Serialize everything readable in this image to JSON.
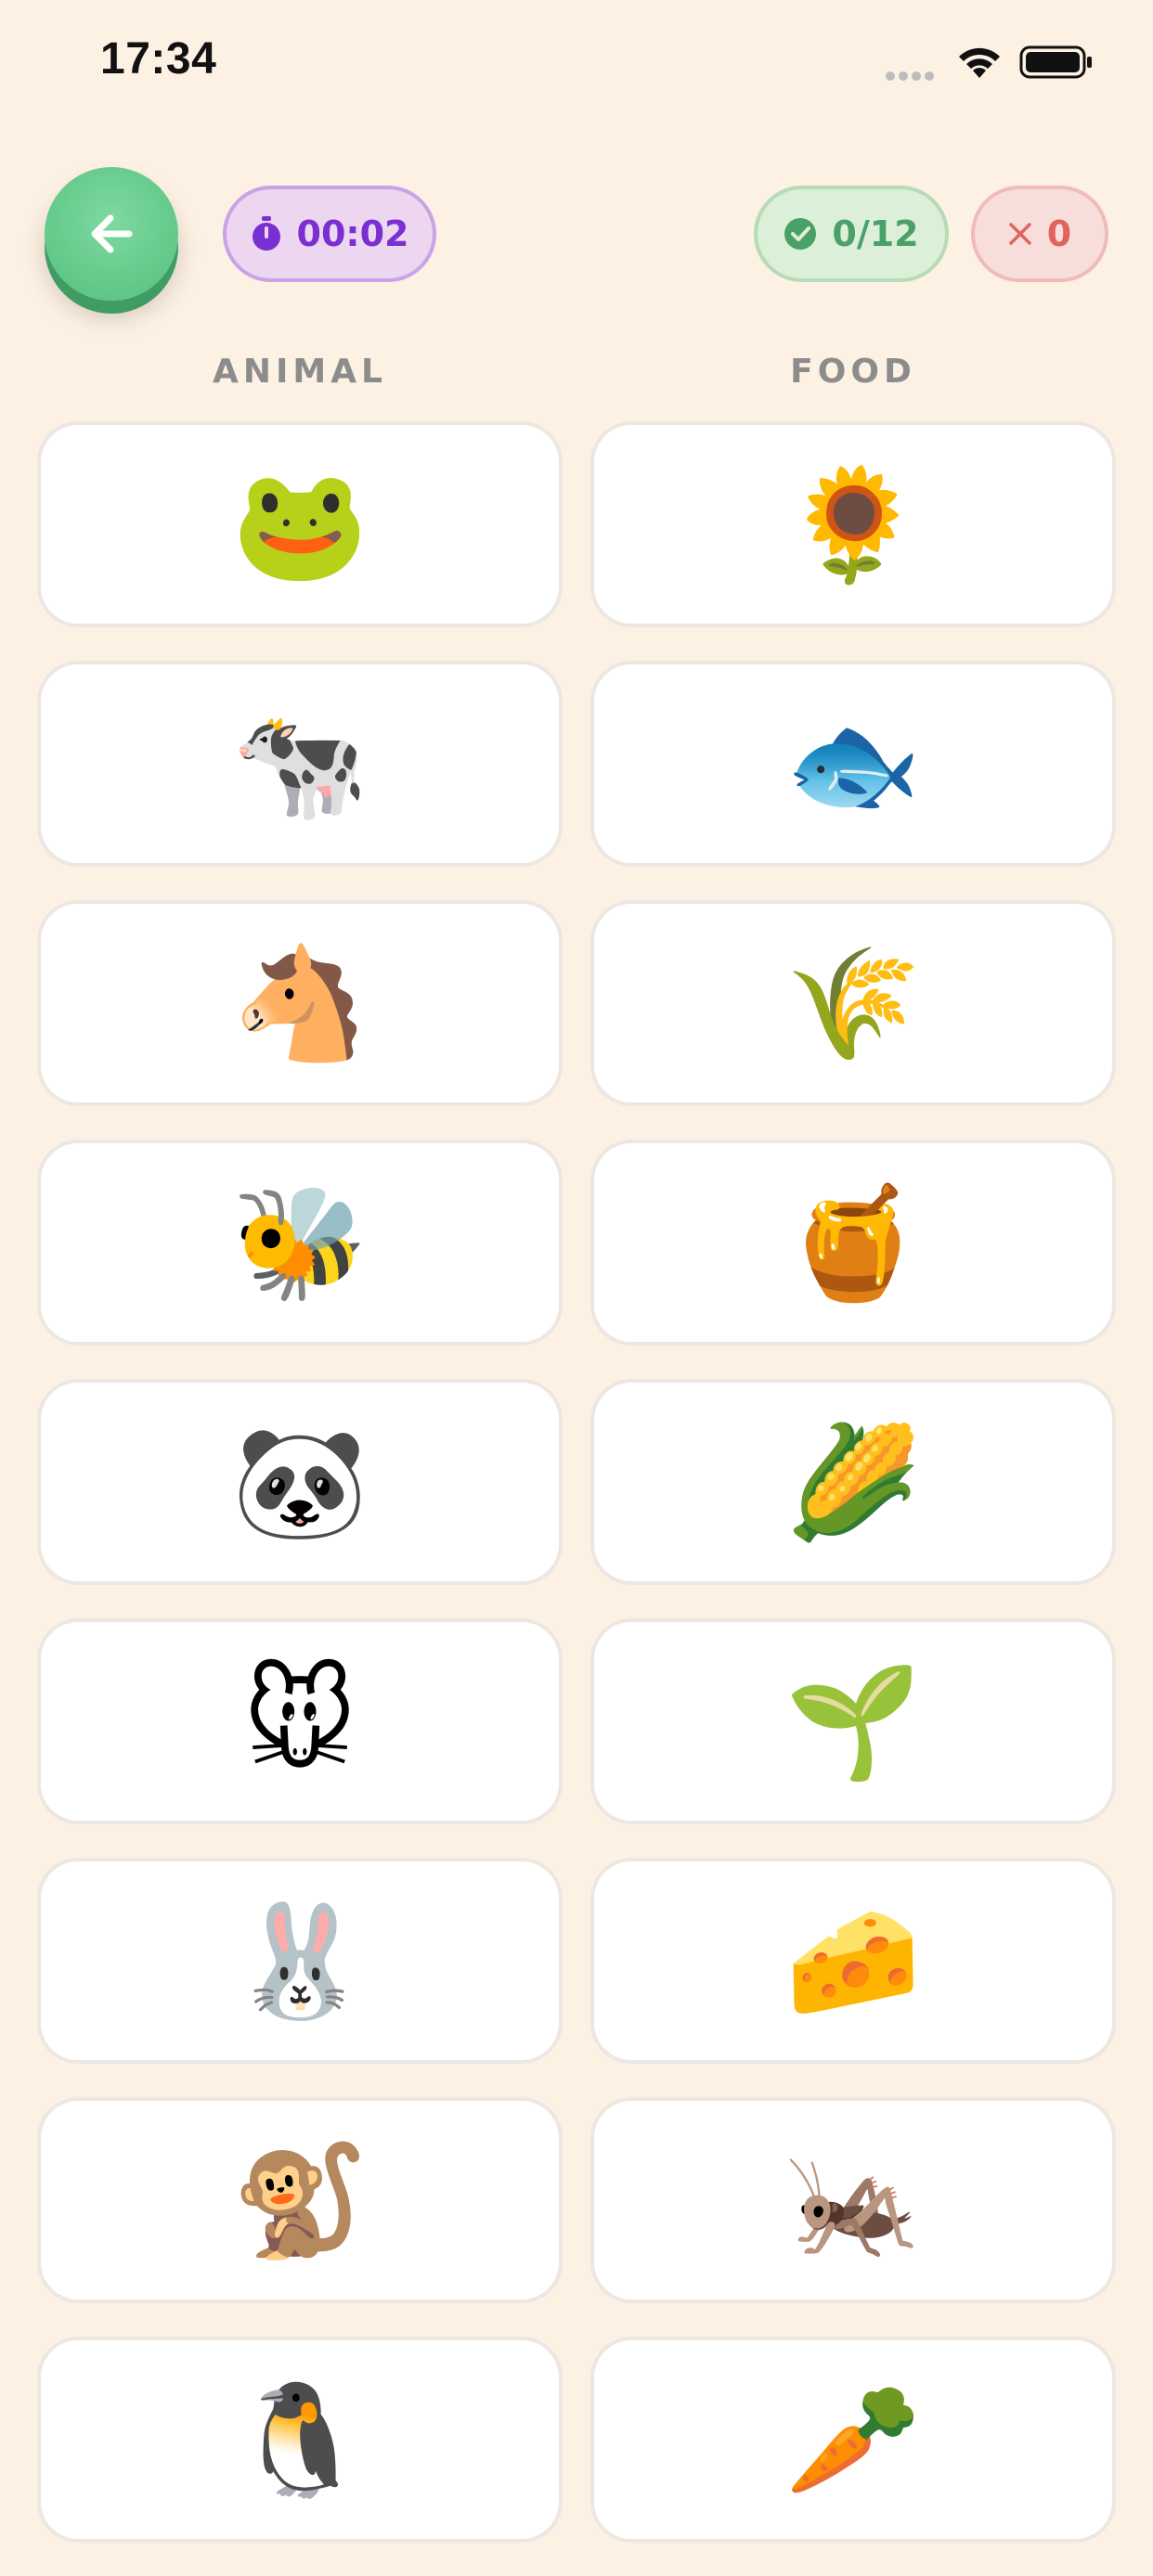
{
  "status_bar": {
    "time": "17:34"
  },
  "toolbar": {
    "back_icon": "arrow-left-icon",
    "timer": {
      "icon": "stopwatch-icon",
      "value": "00:02"
    },
    "correct": {
      "icon": "check-circle-icon",
      "value": "0/12"
    },
    "wrong": {
      "icon": "close-icon",
      "value": "0"
    }
  },
  "columns": {
    "left": {
      "header": "ANIMAL",
      "items": [
        {
          "icon": "frog-icon",
          "emoji": "🐸"
        },
        {
          "icon": "cow-icon",
          "emoji": "🐄"
        },
        {
          "icon": "horse-icon",
          "emoji": "🐴"
        },
        {
          "icon": "bee-icon",
          "emoji": "🐝"
        },
        {
          "icon": "panda-icon",
          "emoji": "🐼"
        },
        {
          "icon": "mouse-icon",
          "emoji": "🐭"
        },
        {
          "icon": "rabbit-icon",
          "emoji": "🐰"
        },
        {
          "icon": "monkey-icon",
          "emoji": "🐒"
        },
        {
          "icon": "penguin-icon",
          "emoji": "🐧"
        }
      ]
    },
    "right": {
      "header": "FOOD",
      "items": [
        {
          "icon": "sunflower-icon",
          "emoji": "🌻"
        },
        {
          "icon": "fish-icon",
          "emoji": "🐟"
        },
        {
          "icon": "wheat-icon",
          "emoji": "🌾"
        },
        {
          "icon": "honey-pot-icon",
          "emoji": "🍯"
        },
        {
          "icon": "corn-icon",
          "emoji": "🌽"
        },
        {
          "icon": "grass-icon",
          "emoji": "🌱"
        },
        {
          "icon": "cheese-icon",
          "emoji": "🧀"
        },
        {
          "icon": "cricket-icon",
          "emoji": "🦗"
        },
        {
          "icon": "carrot-icon",
          "emoji": "🥕"
        }
      ]
    }
  }
}
